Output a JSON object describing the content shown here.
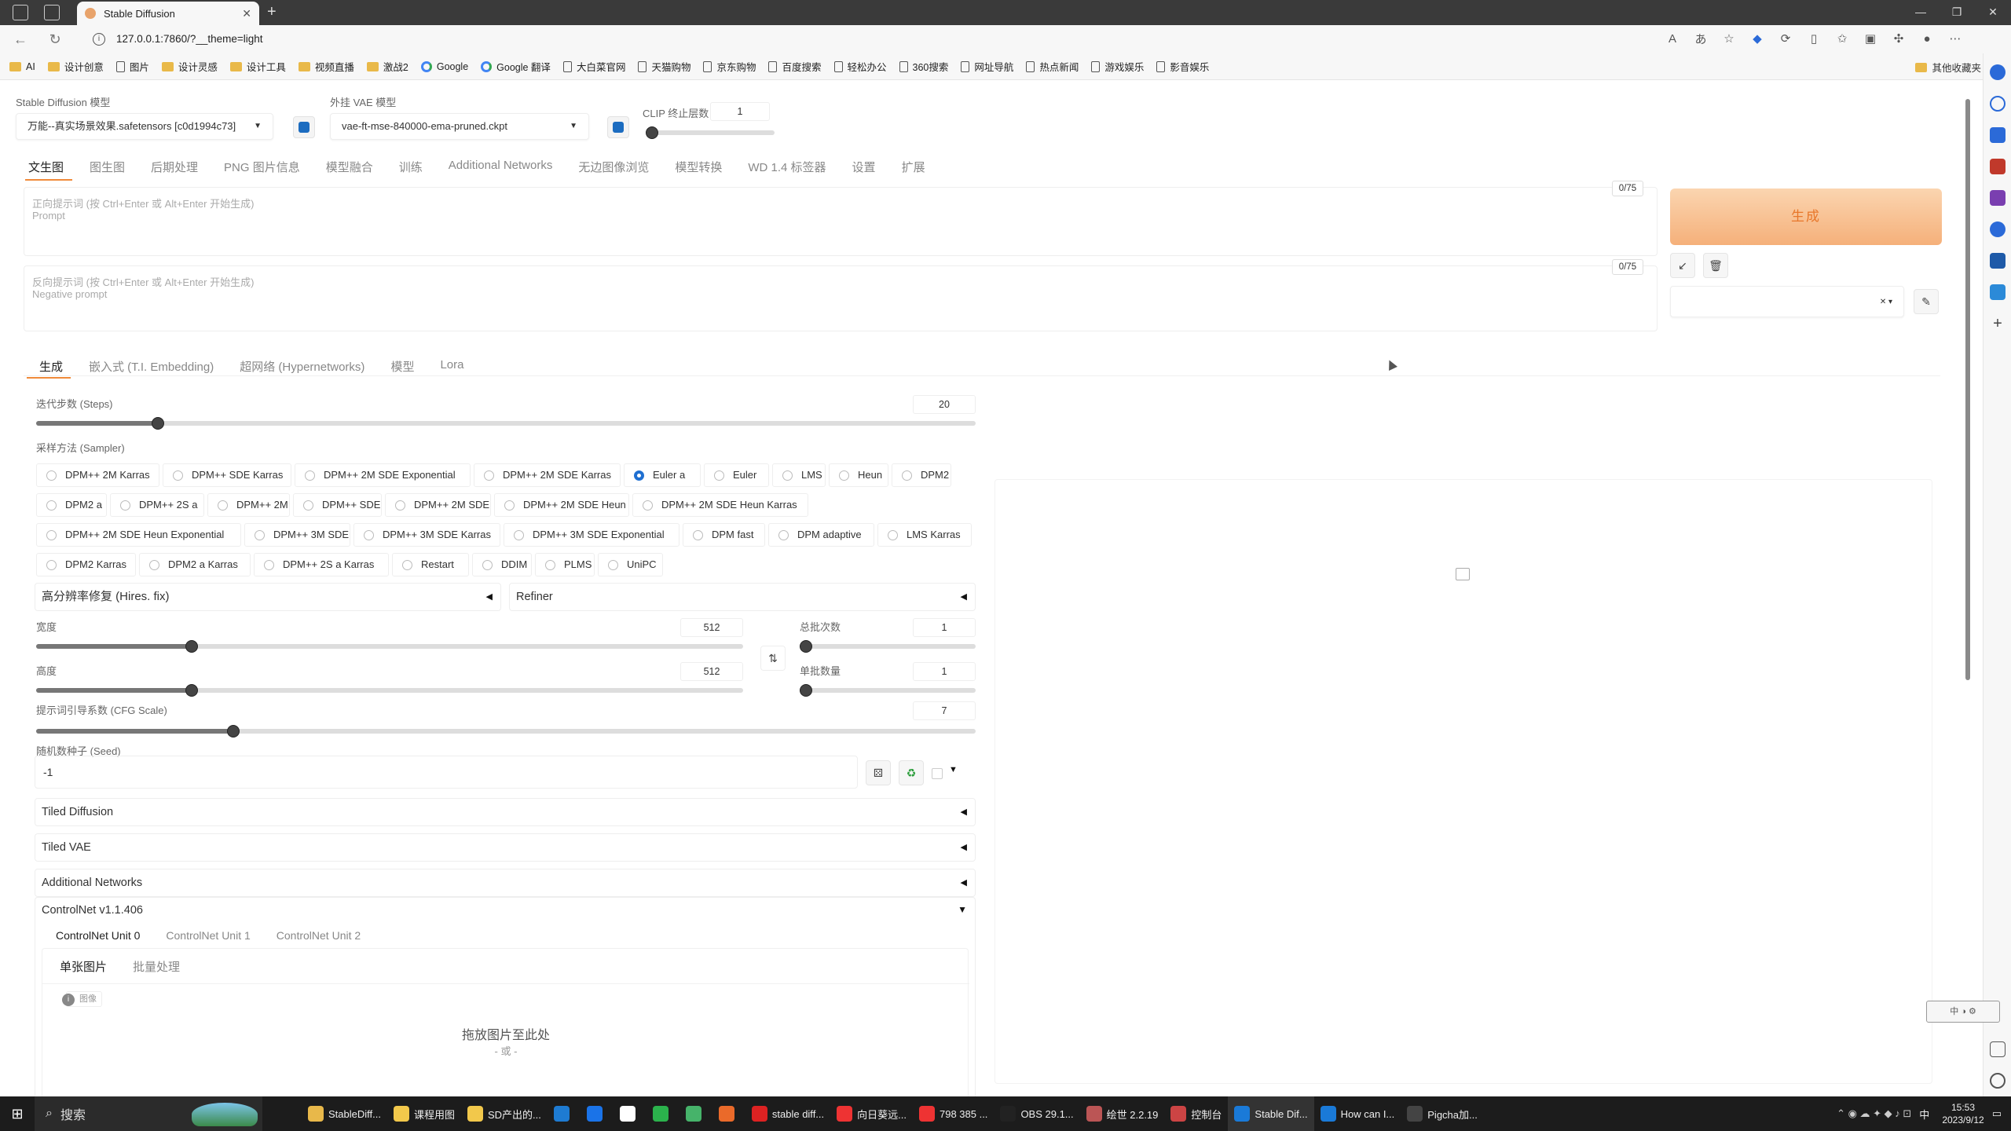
{
  "browser": {
    "tab_title": "Stable Diffusion",
    "url": "127.0.0.1:7860/?__theme=light",
    "bookmarks": [
      "AI",
      "设计创意",
      "图片",
      "设计灵感",
      "设计工具",
      "视频直播",
      "激战2",
      "Google",
      "Google 翻译",
      "大白菜官网",
      "天猫购物",
      "京东购物",
      "百度搜索",
      "轻松办公",
      "360搜索",
      "网址导航",
      "热点新闻",
      "游戏娱乐",
      "影音娱乐"
    ],
    "bookmarks_other": "其他收藏夹"
  },
  "top": {
    "model_label": "Stable Diffusion 模型",
    "model_value": "万能--真实场景效果.safetensors [c0d1994c73]",
    "vae_label": "外挂 VAE 模型",
    "vae_value": "vae-ft-mse-840000-ema-pruned.ckpt",
    "clip_label": "CLIP 终止层数",
    "clip_value": "1",
    "clip_fraction": 0.0
  },
  "main_tabs": [
    "文生图",
    "图生图",
    "后期处理",
    "PNG 图片信息",
    "模型融合",
    "训练",
    "Additional Networks",
    "无边图像浏览",
    "模型转换",
    "WD 1.4 标签器",
    "设置",
    "扩展"
  ],
  "prompt": {
    "positive_placeholder": "正向提示词 (按 Ctrl+Enter 或 Alt+Enter 开始生成)",
    "positive_sub": "Prompt",
    "positive_count": "0/75",
    "negative_placeholder": "反向提示词 (按 Ctrl+Enter 或 Alt+Enter 开始生成)",
    "negative_sub": "Negative prompt",
    "negative_count": "0/75"
  },
  "generate_label": "生成",
  "sub_tabs": [
    "生成",
    "嵌入式 (T.I. Embedding)",
    "超网络 (Hypernetworks)",
    "模型",
    "Lora"
  ],
  "steps": {
    "label": "迭代步数 (Steps)",
    "value": "20",
    "fraction": 0.13
  },
  "sampler": {
    "label": "采样方法 (Sampler)",
    "selected": "Euler a",
    "rows": [
      [
        "DPM++ 2M Karras",
        "DPM++ SDE Karras",
        "DPM++ 2M SDE Exponential",
        "DPM++ 2M SDE Karras",
        "Euler a",
        "Euler",
        "LMS",
        "Heun",
        "DPM2"
      ],
      [
        "DPM2 a",
        "DPM++ 2S a",
        "DPM++ 2M",
        "DPM++ SDE",
        "DPM++ 2M SDE",
        "DPM++ 2M SDE Heun",
        "DPM++ 2M SDE Heun Karras"
      ],
      [
        "DPM++ 2M SDE Heun Exponential",
        "DPM++ 3M SDE",
        "DPM++ 3M SDE Karras",
        "DPM++ 3M SDE Exponential",
        "DPM fast",
        "DPM adaptive",
        "LMS Karras"
      ],
      [
        "DPM2 Karras",
        "DPM2 a Karras",
        "DPM++ 2S a Karras",
        "Restart",
        "DDIM",
        "PLMS",
        "UniPC"
      ]
    ]
  },
  "hires": {
    "label": "高分辨率修复 (Hires. fix)"
  },
  "refiner": {
    "label": "Refiner"
  },
  "width": {
    "label": "宽度",
    "value": "512",
    "fraction": 0.22
  },
  "height": {
    "label": "高度",
    "value": "512",
    "fraction": 0.22
  },
  "batch_count": {
    "label": "总批次数",
    "value": "1",
    "fraction": 0.0
  },
  "batch_size": {
    "label": "单批数量",
    "value": "1",
    "fraction": 0.0
  },
  "cfg": {
    "label": "提示词引导系数 (CFG Scale)",
    "value": "7",
    "fraction": 0.21
  },
  "seed": {
    "label": "随机数种子 (Seed)",
    "value": "-1"
  },
  "accordions": [
    "Tiled Diffusion",
    "Tiled VAE",
    "Additional Networks"
  ],
  "controlnet": {
    "label": "ControlNet v1.1.406",
    "units": [
      "ControlNet Unit 0",
      "ControlNet Unit 1",
      "ControlNet Unit 2"
    ],
    "modes": [
      "单张图片",
      "批量处理"
    ],
    "image_badge": "图像",
    "drop_text": "拖放图片至此处",
    "or_text": "- 或 -"
  },
  "taskbar": {
    "search": "搜索",
    "items": [
      "StableDiff...",
      "课程用图",
      "SD产出的...",
      "stable diff...",
      "向日葵远...",
      "798 385 ...",
      "OBS 29.1...",
      "绘世 2.2.19",
      "控制台",
      "Stable Dif...",
      "How can I...",
      "Pigcha加..."
    ],
    "time": "15:53",
    "date": "2023/9/12"
  },
  "colors": {
    "accent": "#f08a3a",
    "generate_bg": "#f5b07a",
    "radio_selected": "#1f6fd1"
  }
}
